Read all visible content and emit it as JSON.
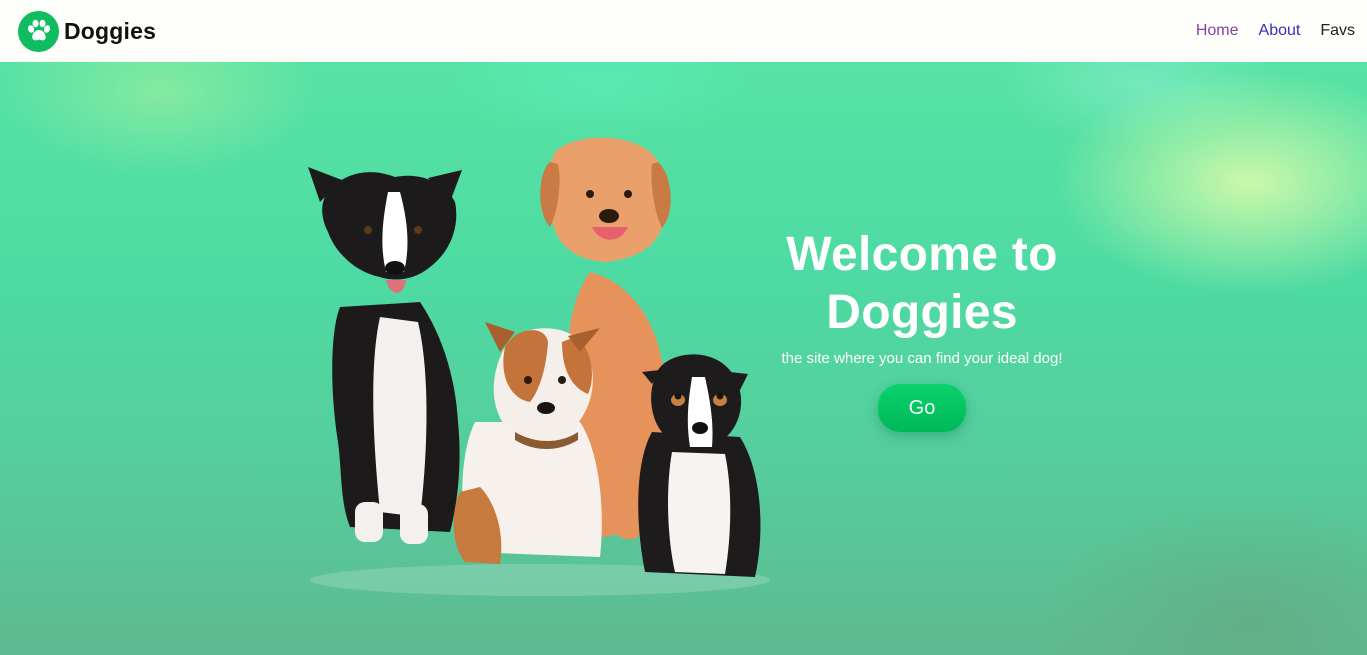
{
  "brand": {
    "name": "Doggies",
    "logo_icon": "paw-icon",
    "logo_color": "#0fbd60"
  },
  "nav": {
    "items": [
      {
        "label": "Home",
        "color": "#8a3fa3"
      },
      {
        "label": "About",
        "color": "#3a2fb8"
      },
      {
        "label": "Favs",
        "color": "#222222"
      }
    ]
  },
  "hero": {
    "title_line1": "Welcome to",
    "title_line2": "Doggies",
    "subtitle": "the site where you can find your ideal dog!",
    "cta_label": "Go",
    "cta_color": "#09d26b",
    "image_icon": "dogs-group-photo"
  }
}
